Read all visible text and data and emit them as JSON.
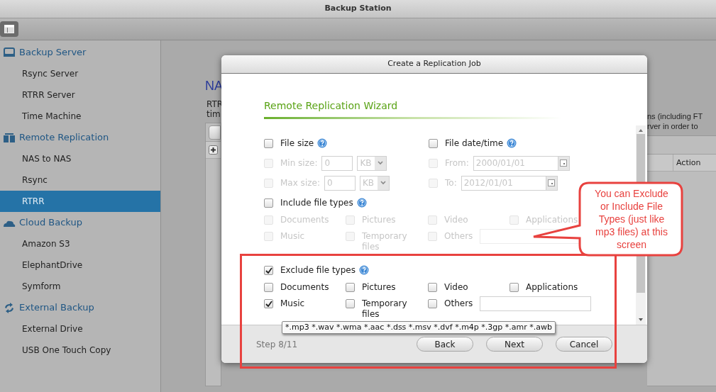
{
  "window": {
    "title": "Backup Station"
  },
  "sidebar": {
    "groups": [
      {
        "kind": "drive",
        "label": "Backup Server",
        "items": [
          {
            "label": "Rsync Server",
            "selected": false
          },
          {
            "label": "RTRR Server",
            "selected": false
          },
          {
            "label": "Time Machine",
            "selected": false
          }
        ]
      },
      {
        "kind": "servers",
        "label": "Remote Replication",
        "items": [
          {
            "label": "NAS to NAS",
            "selected": false
          },
          {
            "label": "Rsync",
            "selected": false
          },
          {
            "label": "RTRR",
            "selected": true
          }
        ]
      },
      {
        "kind": "cloud",
        "label": "Cloud Backup",
        "items": [
          {
            "label": "Amazon S3",
            "selected": false
          },
          {
            "label": "ElephantDrive",
            "selected": false
          },
          {
            "label": "Symform",
            "selected": false
          }
        ]
      },
      {
        "kind": "sync",
        "label": "External Backup",
        "items": [
          {
            "label": "External Drive",
            "selected": false
          },
          {
            "label": "USB One Touch Copy",
            "selected": false
          }
        ]
      }
    ]
  },
  "background_page": {
    "heading": "NA",
    "lines_left": [
      "RTR",
      "tim"
    ],
    "lines_right": [
      "ns (including FT",
      "rver in order to"
    ],
    "table_column": "Action"
  },
  "dialog": {
    "title": "Create a Replication Job",
    "wizard_title": "Remote Replication Wizard",
    "size_filter": {
      "label": "File size",
      "checked": false,
      "rows": [
        {
          "label": "Min size:",
          "checked": false,
          "disabled": true,
          "value": "0",
          "unit": "KB"
        },
        {
          "label": "Max size:",
          "checked": false,
          "disabled": true,
          "value": "0",
          "unit": "KB"
        }
      ]
    },
    "date_filter": {
      "label": "File date/time",
      "checked": false,
      "rows": [
        {
          "label": "From:",
          "checked": false,
          "disabled": true,
          "value": "2000/01/01"
        },
        {
          "label": "To:",
          "checked": false,
          "disabled": true,
          "value": "2012/01/01"
        }
      ]
    },
    "type_filters": [
      {
        "label": "Include file types",
        "checked": false,
        "options": [
          {
            "kind": "plain",
            "label": "Documents",
            "checked": false,
            "disabled": true
          },
          {
            "kind": "plain",
            "label": "Pictures",
            "checked": false,
            "disabled": true
          },
          {
            "kind": "plain",
            "label": "Video",
            "checked": false,
            "disabled": true
          },
          {
            "kind": "plain",
            "label": "Applications",
            "checked": false,
            "disabled": true
          },
          {
            "kind": "plain",
            "label": "Music",
            "checked": false,
            "disabled": true
          },
          {
            "kind": "plain",
            "label": "Temporary files",
            "checked": false,
            "disabled": true
          },
          {
            "kind": "other",
            "label": "Others",
            "checked": false,
            "disabled": true
          }
        ]
      },
      {
        "label": "Exclude file types",
        "checked": true,
        "options": [
          {
            "kind": "plain",
            "label": "Documents",
            "checked": false,
            "disabled": false
          },
          {
            "kind": "plain",
            "label": "Pictures",
            "checked": false,
            "disabled": false
          },
          {
            "kind": "plain",
            "label": "Video",
            "checked": false,
            "disabled": false
          },
          {
            "kind": "plain",
            "label": "Applications",
            "checked": false,
            "disabled": false
          },
          {
            "kind": "plain",
            "label": "Music",
            "checked": true,
            "disabled": false
          },
          {
            "kind": "plain",
            "label": "Temporary files",
            "checked": false,
            "disabled": false
          },
          {
            "kind": "other",
            "label": "Others",
            "checked": false,
            "disabled": false
          }
        ]
      }
    ],
    "tooltip": "*.mp3 *.wav *.wma *.aac *.dss *.msv *.dvf *.m4p *.3gp *.amr *.awb",
    "step": "Step 8/11",
    "buttons": [
      "Back",
      "Next",
      "Cancel"
    ]
  },
  "annotation": {
    "text": "You can Exclude or Include File Types (just like mp3 files) at this screen"
  }
}
